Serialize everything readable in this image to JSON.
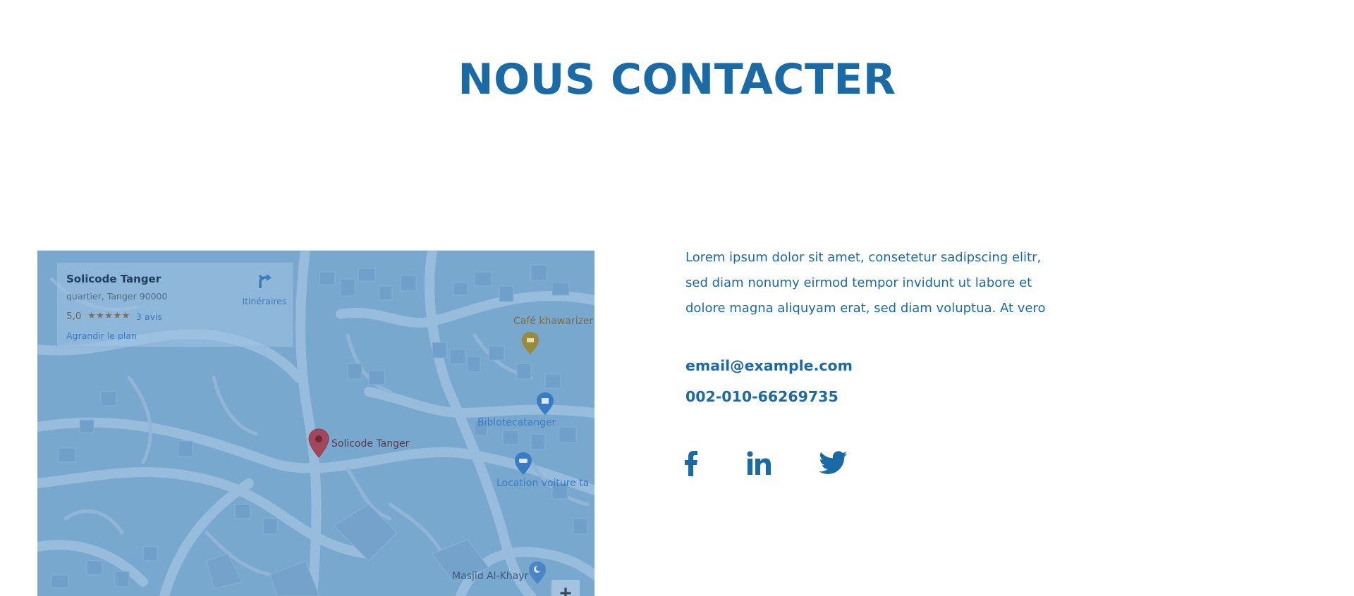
{
  "section": {
    "title": "NOUS CONTACTER"
  },
  "map": {
    "place_name": "Solicode Tanger",
    "address": "quartier, Tanger 90000",
    "rating": "5,0",
    "stars": "★★★★★",
    "reviews": "3 avis",
    "enlarge_link": "Agrandir le plan",
    "directions_label": "Itinéraires",
    "zoom_in": "+",
    "pins": {
      "main": "Solicode Tanger",
      "cafe": "Café khawarizer",
      "library": "Biblotecatanger",
      "car_rental": "Location voiture ta",
      "mosque": "Masjid Al-Khayr"
    },
    "colors": {
      "main_pin": "#a5475c",
      "cafe_pin": "#9a8a3e",
      "blue_pin": "#3b7bc4"
    }
  },
  "contact": {
    "intro_lines": [
      "Lorem ipsum dolor sit amet, consetetur sadipscing elitr,",
      "sed diam nonumy eirmod tempor invidunt ut labore et",
      "dolore magna aliquyam erat, sed diam voluptua. At vero"
    ],
    "email": "email@example.com",
    "phone": "002-010-66269735",
    "social": [
      "facebook-icon",
      "linkedin-icon",
      "twitter-icon"
    ]
  },
  "colors": {
    "brand_blue": "#1a6aa6",
    "map_tint": "#84afd3"
  }
}
